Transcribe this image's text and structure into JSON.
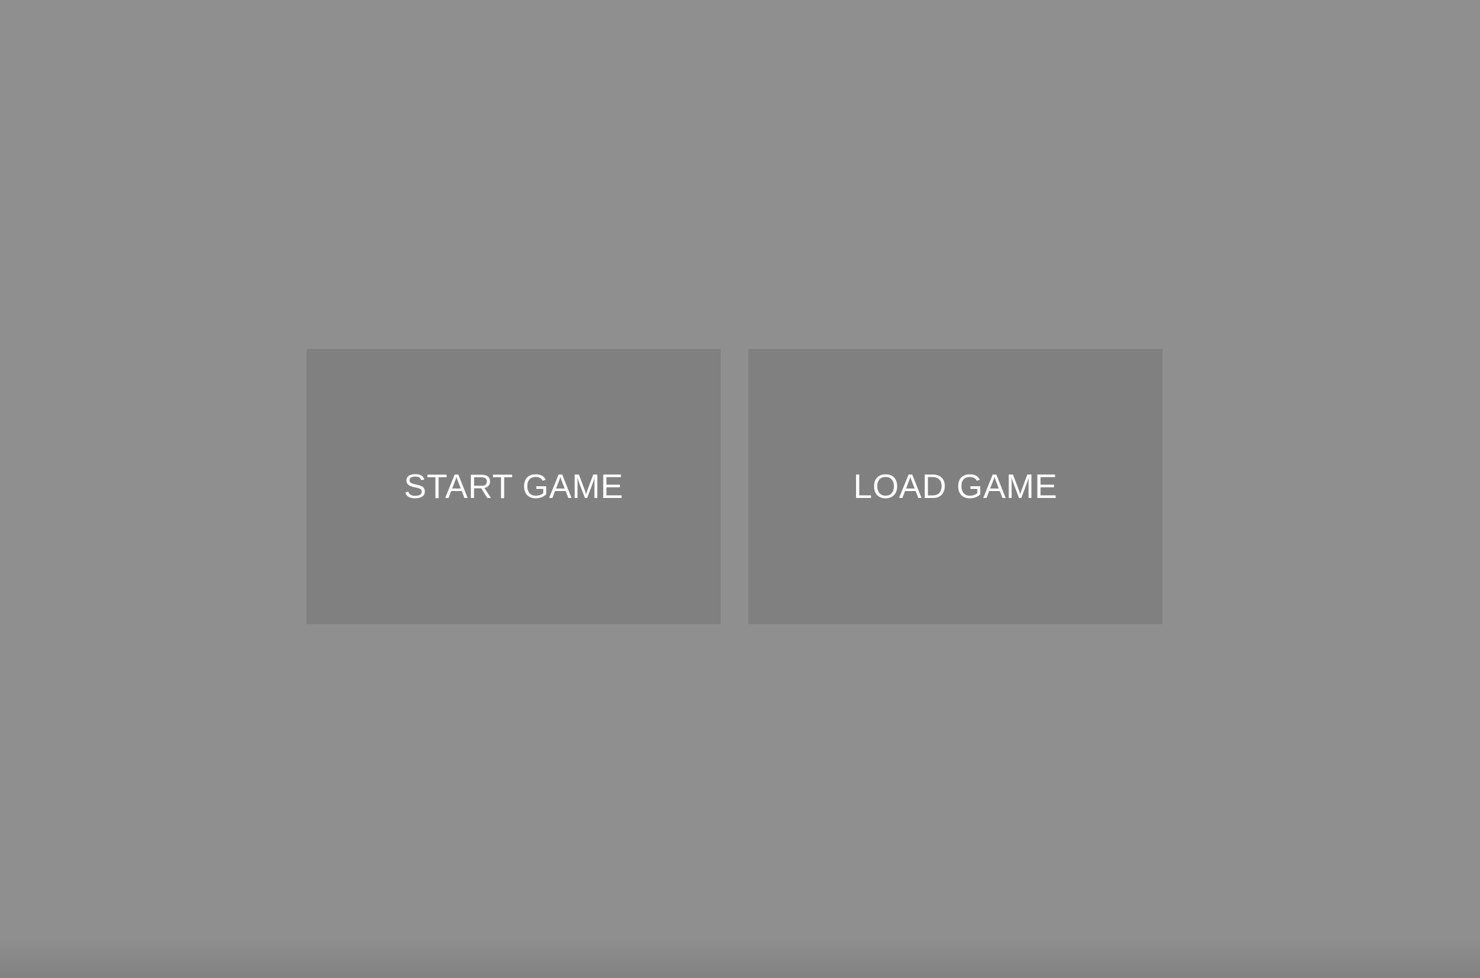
{
  "menu": {
    "start_label": "START GAME",
    "load_label": "LOAD GAME"
  },
  "colors": {
    "background": "#8f8f8f",
    "button": "#808080",
    "label": "#ffffff"
  }
}
